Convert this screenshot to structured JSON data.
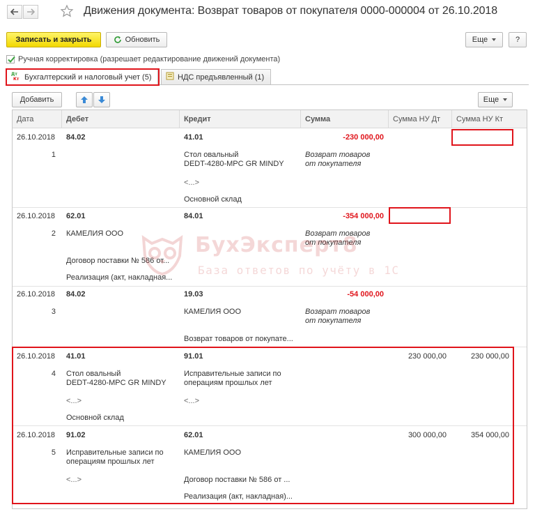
{
  "window": {
    "title": "Движения документа: Возврат товаров от покупателя 0000-000004 от 26.10.2018"
  },
  "toolbar": {
    "save_close_label": "Записать и закрыть",
    "refresh_label": "Обновить",
    "more_label": "Еще",
    "help_label": "?"
  },
  "manual": {
    "label": "Ручная корректировка (разрешает редактирование движений документа)",
    "checked": true
  },
  "tabs": [
    {
      "label": "Бухгалтерский и налоговый учет (5)",
      "icon_text": "Дт Кт",
      "active": true
    },
    {
      "label": "НДС предъявленный (1)",
      "active": false
    }
  ],
  "table_toolbar": {
    "add_label": "Добавить",
    "more_label": "Еще"
  },
  "columns": [
    "Дата",
    "Дебет",
    "Кредит",
    "Сумма",
    "Сумма НУ Дт",
    "Сумма НУ Кт"
  ],
  "rows": [
    {
      "date": "26.10.2018",
      "num": "1",
      "debit": [
        "84.02",
        "",
        "",
        ""
      ],
      "credit": [
        "41.01",
        "Стол овальный\nDEDT-4280-MPC GR MINDY",
        "<...>",
        "Основной склад"
      ],
      "sum": "-230 000,00",
      "content": "Возврат товаров\nот покупателя",
      "nu_dt": "",
      "nu_kt": ""
    },
    {
      "date": "26.10.2018",
      "num": "2",
      "debit": [
        "62.01",
        "КАМЕЛИЯ ООО",
        "Договор поставки № 586 от...",
        "Реализация (акт, накладная..."
      ],
      "credit": [
        "84.01",
        "",
        "",
        ""
      ],
      "sum": "-354 000,00",
      "content": "Возврат товаров\nот покупателя",
      "nu_dt": "",
      "nu_kt": ""
    },
    {
      "date": "26.10.2018",
      "num": "3",
      "debit": [
        "84.02",
        "",
        "",
        ""
      ],
      "credit": [
        "19.03",
        "КАМЕЛИЯ ООО",
        "",
        "Возврат товаров от покупате..."
      ],
      "sum": "-54 000,00",
      "content": "Возврат товаров\nот покупателя",
      "nu_dt": "",
      "nu_kt": ""
    },
    {
      "date": "26.10.2018",
      "num": "4",
      "debit": [
        "41.01",
        "Стол овальный\nDEDT-4280-MPC GR MINDY",
        "<...>",
        "Основной склад"
      ],
      "credit": [
        "91.01",
        "Исправительные записи по\nоперациям прошлых лет",
        "<...>",
        ""
      ],
      "sum": "",
      "content": "",
      "nu_dt": "230 000,00",
      "nu_kt": "230 000,00"
    },
    {
      "date": "26.10.2018",
      "num": "5",
      "debit": [
        "91.02",
        "Исправительные записи по\nоперациям прошлых лет",
        "<...>",
        ""
      ],
      "credit": [
        "62.01",
        "КАМЕЛИЯ ООО",
        "Договор поставки № 586 от ...",
        "Реализация (акт, накладная)..."
      ],
      "sum": "",
      "content": "",
      "nu_dt": "300 000,00",
      "nu_kt": "354 000,00"
    }
  ],
  "watermark": {
    "title": "БухЭксперт8",
    "subtitle": "База ответов по учёту в 1С"
  },
  "colors": {
    "accent_yellow": "#f5dc00",
    "highlight_red": "#e0141b",
    "negative_red": "#e0141b"
  }
}
